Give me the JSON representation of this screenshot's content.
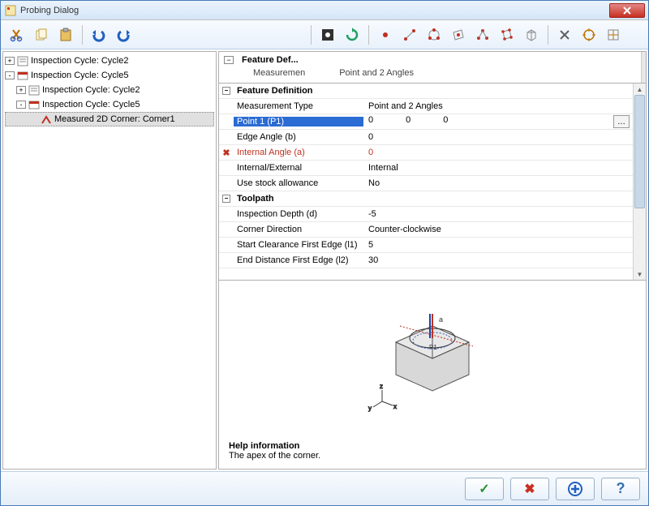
{
  "window": {
    "title": "Probing Dialog"
  },
  "tree": [
    {
      "expander": "+",
      "indent": 0,
      "icon": "cycle-icon",
      "label": "Inspection Cycle: Cycle2",
      "selected": false
    },
    {
      "expander": "-",
      "indent": 0,
      "icon": "cycle-open-icon",
      "label": "Inspection Cycle: Cycle5",
      "selected": false
    },
    {
      "expander": "+",
      "indent": 1,
      "icon": "cycle-icon",
      "label": "Inspection Cycle: Cycle2",
      "selected": false
    },
    {
      "expander": "-",
      "indent": 1,
      "icon": "cycle-open-icon",
      "label": "Inspection Cycle: Cycle5",
      "selected": false
    },
    {
      "expander": "",
      "indent": 2,
      "icon": "corner-icon",
      "label": "Measured 2D Corner: Corner1",
      "selected": true
    }
  ],
  "miniHeader": {
    "label": "Feature Def...",
    "subLabel1": "Measuremen",
    "subLabel2": "Point and 2 Angles"
  },
  "props": {
    "groups": [
      {
        "name": "Feature Definition",
        "rows": [
          {
            "name": "Measurement Type",
            "value": "Point and 2 Angles"
          },
          {
            "name": "Point 1 (P1)",
            "valueCols": [
              "0",
              "0",
              "0"
            ],
            "selected": true,
            "ellipsis": true
          },
          {
            "name": "Edge Angle (b)",
            "value": "0"
          },
          {
            "name": "Internal Angle (a)",
            "value": "0",
            "error": true
          },
          {
            "name": "Internal/External",
            "value": "Internal"
          },
          {
            "name": "Use stock allowance",
            "value": "No"
          }
        ]
      },
      {
        "name": "Toolpath",
        "rows": [
          {
            "name": "Inspection Depth (d)",
            "value": "-5"
          },
          {
            "name": "Corner Direction",
            "value": "Counter-clockwise"
          },
          {
            "name": "Start Clearance First Edge (l1)",
            "value": "5"
          },
          {
            "name": "End Distance First Edge (l2)",
            "value": "30"
          }
        ]
      }
    ]
  },
  "help": {
    "heading": "Help information",
    "text": "The apex of the corner."
  },
  "buttons": {
    "ok": "✓",
    "cancel": "✖",
    "add": "＋",
    "helpq": "?"
  }
}
